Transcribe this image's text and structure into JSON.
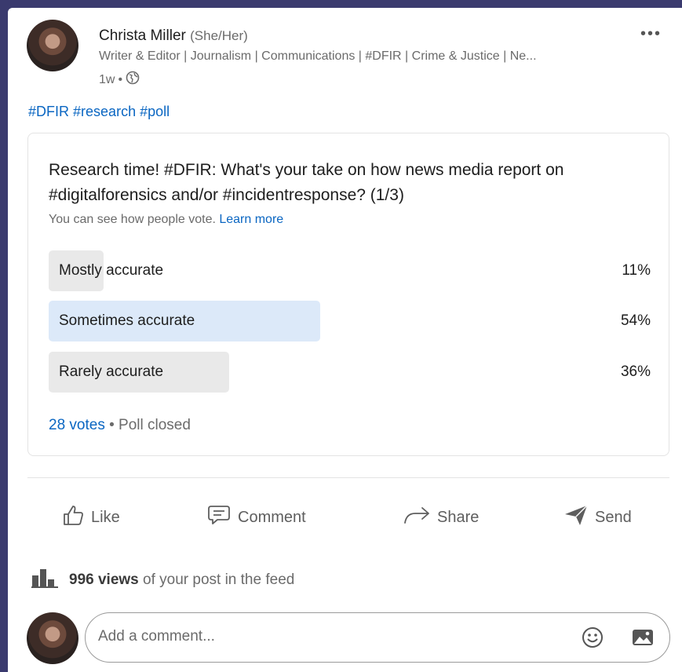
{
  "post": {
    "author": {
      "name": "Christa Miller",
      "pronouns": "(She/Her)"
    },
    "headline": "Writer & Editor | Journalism | Communications | #DFIR | Crime & Justice | Ne...",
    "time": "1w",
    "separator": "•",
    "visibility_icon": "globe-icon",
    "more_label": "•••",
    "hashtags": [
      "#DFIR",
      "#research",
      "#poll"
    ]
  },
  "poll": {
    "question": "Research time! #DFIR: What's your take on how news media report on #digitalforensics and/or #incidentresponse? (1/3)",
    "note": "You can see how people vote.",
    "learn_more": "Learn more",
    "options": [
      {
        "label": "Mostly accurate",
        "percent": "11%",
        "fraction": 0.11,
        "voted": false
      },
      {
        "label": "Sometimes accurate",
        "percent": "54%",
        "fraction": 0.54,
        "voted": true
      },
      {
        "label": "Rarely accurate",
        "percent": "36%",
        "fraction": 0.36,
        "voted": false
      }
    ],
    "votes": "28 votes",
    "separator": "•",
    "status": "Poll closed"
  },
  "actions": {
    "like": "Like",
    "comment": "Comment",
    "share": "Share",
    "send": "Send"
  },
  "stats": {
    "views_count": "996 views",
    "views_suffix": "of your post in the feed"
  },
  "comment": {
    "placeholder": "Add a comment..."
  },
  "colors": {
    "accent": "#0a66c2",
    "voted_bar": "#dce9f9",
    "bar": "#e9e9e9",
    "frame": "#3a3a6e"
  }
}
